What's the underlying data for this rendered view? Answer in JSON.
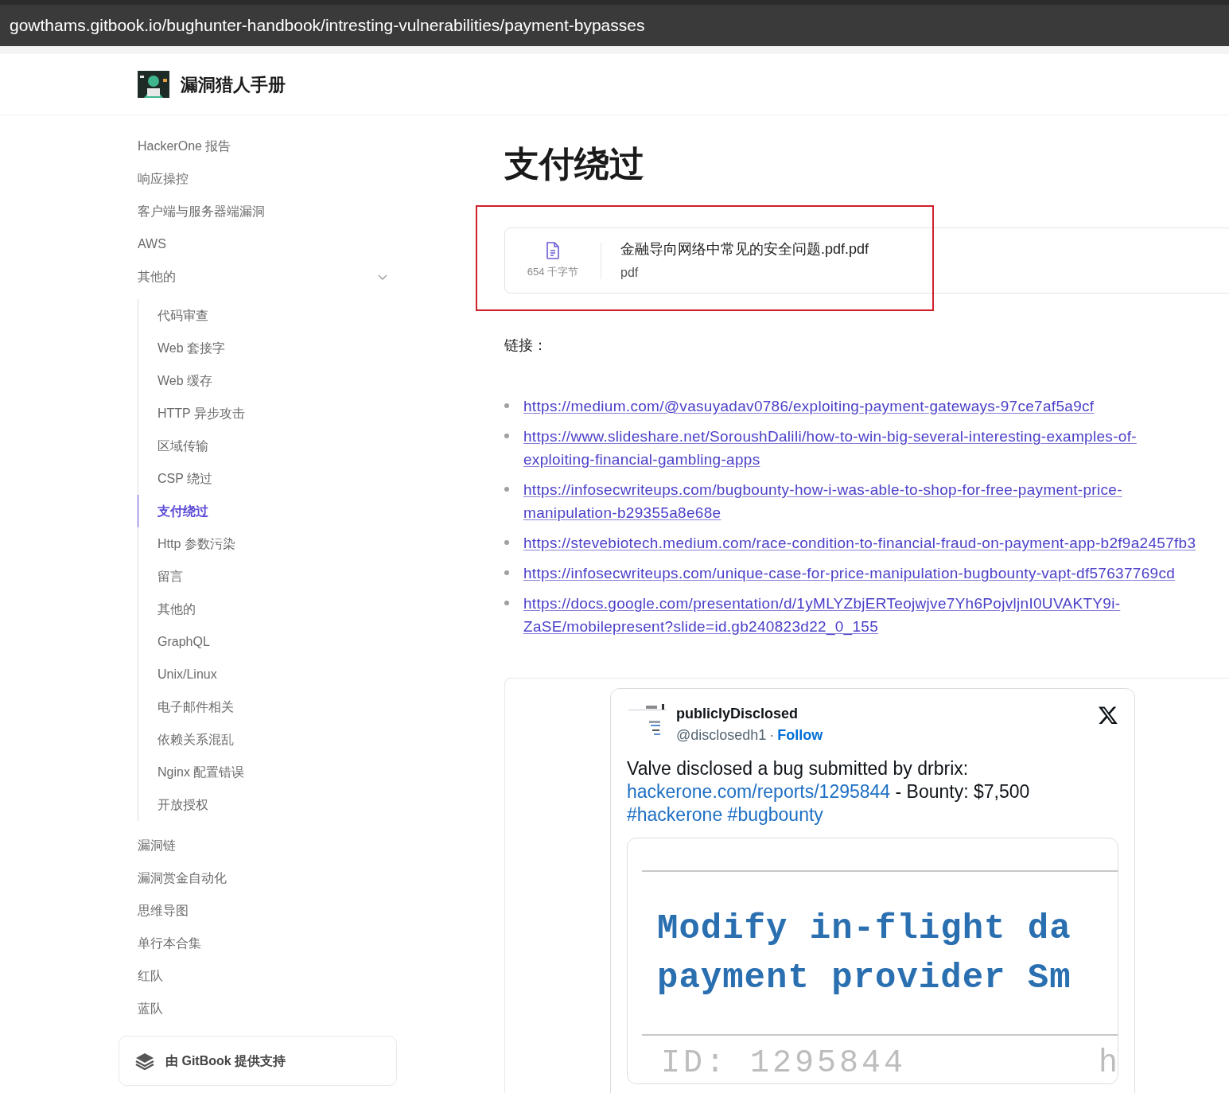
{
  "address_bar": {
    "url": "gowthams.gitbook.io/bughunter-handbook/intresting-vulnerabilities/payment-bypasses"
  },
  "header": {
    "site_title": "漏洞猎人手册"
  },
  "sidebar": {
    "items": [
      {
        "label": "HackerOne 报告",
        "selected": false
      },
      {
        "label": "响应操控",
        "selected": false
      },
      {
        "label": "客户端与服务器端漏洞",
        "selected": false
      },
      {
        "label": "AWS",
        "selected": false
      },
      {
        "label": "其他的",
        "selected": false,
        "expanded": true,
        "children": [
          {
            "label": "代码审查",
            "selected": false
          },
          {
            "label": "Web 套接字",
            "selected": false
          },
          {
            "label": "Web 缓存",
            "selected": false
          },
          {
            "label": "HTTP 异步攻击",
            "selected": false
          },
          {
            "label": "区域传输",
            "selected": false
          },
          {
            "label": "CSP 绕过",
            "selected": false
          },
          {
            "label": "支付绕过",
            "selected": true
          },
          {
            "label": "Http 参数污染",
            "selected": false
          },
          {
            "label": "留言",
            "selected": false
          },
          {
            "label": "其他的",
            "selected": false
          },
          {
            "label": "GraphQL",
            "selected": false
          },
          {
            "label": "Unix/Linux",
            "selected": false
          },
          {
            "label": "电子邮件相关",
            "selected": false
          },
          {
            "label": "依赖关系混乱",
            "selected": false
          },
          {
            "label": "Nginx 配置错误",
            "selected": false
          },
          {
            "label": "开放授权",
            "selected": false
          }
        ]
      },
      {
        "label": "漏洞链",
        "selected": false
      },
      {
        "label": "漏洞赏金自动化",
        "selected": false
      },
      {
        "label": "思维导图",
        "selected": false
      },
      {
        "label": "单行本合集",
        "selected": false
      },
      {
        "label": "红队",
        "selected": false
      },
      {
        "label": "蓝队",
        "selected": false
      }
    ]
  },
  "footer_badge": {
    "label": "由 GitBook 提供支持"
  },
  "page": {
    "title": "支付绕过",
    "attachment": {
      "name": "金融导向网络中常见的安全问题.pdf.pdf",
      "size": "654 千字节",
      "type": "pdf",
      "highlighted": true
    },
    "links_heading": "链接：",
    "links": [
      "https://medium.com/@vasuyadav0786/exploiting-payment-gateways-97ce7af5a9cf",
      "https://www.slideshare.net/SoroushDalili/how-to-win-big-several-interesting-examples-of-exploiting-financial-gambling-apps",
      "https://infosecwriteups.com/bugbounty-how-i-was-able-to-shop-for-free-payment-price-manipulation-b29355a8e68e",
      "https://stevebiotech.medium.com/race-condition-to-financial-fraud-on-payment-app-b2f9a2457fb3",
      "https://infosecwriteups.com/unique-case-for-price-manipulation-bugbounty-vapt-df57637769cd",
      "https://docs.google.com/presentation/d/1yMLYZbjERTeojwjve7Yh6PojvljnI0UVAKTY9i-ZaSE/mobilepresent?slide=id.gb240823d22_0_155"
    ],
    "tweet": {
      "display_name": "publiclyDisclosed",
      "handle": "@disclosedh1",
      "separator": "·",
      "follow": "Follow",
      "body": [
        {
          "kind": "text",
          "text": "Valve disclosed a bug submitted by drbrix:"
        },
        {
          "kind": "link",
          "text": "hackerone.com/reports/1295844"
        },
        {
          "kind": "text",
          "text": " - Bounty: $7,500"
        },
        {
          "kind": "link",
          "text": "#hackerone"
        },
        {
          "kind": "link",
          "text": "#bugbounty"
        }
      ],
      "card": {
        "headline_lines": [
          "Modify in-flight da",
          "payment provider Sm"
        ],
        "id_text": "ID: 1295844",
        "trailing": "h"
      }
    }
  }
}
